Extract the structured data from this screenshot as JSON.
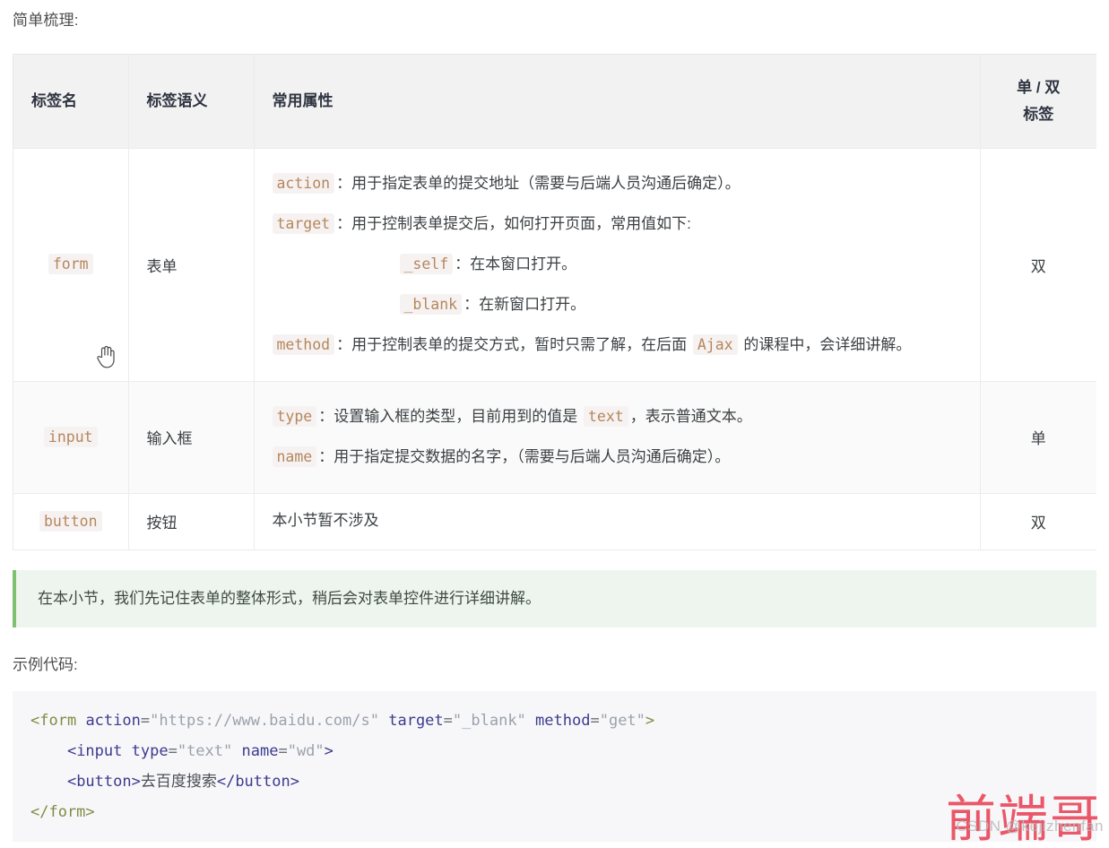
{
  "lead_text": "简单梳理:",
  "table": {
    "headers": {
      "name": "标签名",
      "semantic": "标签语义",
      "attributes": "常用属性",
      "pair_line1": "单 / 双",
      "pair_line2": "标签"
    },
    "rows": [
      {
        "tag": "form",
        "semantic": "表单",
        "pair": "双",
        "attributes": [
          {
            "code": "action",
            "text": "：用于指定表单的提交地址（需要与后端人员沟通后确定）。",
            "indent": false
          },
          {
            "code": "target",
            "text": "：用于控制表单提交后，如何打开页面，常用值如下:",
            "indent": false
          },
          {
            "code": "_self",
            "text": "：在本窗口打开。",
            "indent": true
          },
          {
            "code": "_blank",
            "text": "：在新窗口打开。",
            "indent": true
          },
          {
            "code": "method",
            "text_a": "：用于控制表单的提交方式，暂时只需了解，在后面 ",
            "code_b": "Ajax",
            "text_b": " 的课程中，会详细讲解。",
            "indent": false,
            "wrap": true
          }
        ]
      },
      {
        "tag": "input",
        "semantic": "输入框",
        "pair": "单",
        "attributes": [
          {
            "code": "type",
            "text_a": "：设置输入框的类型，目前用到的值是 ",
            "code_b": "text",
            "text_b": "，表示普通文本。",
            "indent": false
          },
          {
            "code": "name",
            "text": "：用于指定提交数据的名字，（需要与后端人员沟通后确定）。",
            "indent": false
          }
        ]
      },
      {
        "tag": "button",
        "semantic": "按钮",
        "pair": "双",
        "plain_attribute": "本小节暂不涉及"
      }
    ]
  },
  "callout": {
    "text": "在本小节，我们先记住表单的整体形式，稍后会对表单控件进行详细讲解。",
    "accent_color": "#7ec16f",
    "background_color": "#eef5ee"
  },
  "example": {
    "label": "示例代码:",
    "code_lines": [
      {
        "tokens": [
          {
            "t": "<form",
            "c": "tag-green"
          },
          {
            "t": " ",
            "c": "punct"
          },
          {
            "t": "action",
            "c": "attr"
          },
          {
            "t": "=",
            "c": "punct"
          },
          {
            "t": "\"https://www.baidu.com/s\"",
            "c": "str"
          },
          {
            "t": " ",
            "c": "punct"
          },
          {
            "t": "target",
            "c": "attr"
          },
          {
            "t": "=",
            "c": "punct"
          },
          {
            "t": "\"_blank\"",
            "c": "str"
          },
          {
            "t": " ",
            "c": "punct"
          },
          {
            "t": "method",
            "c": "attr"
          },
          {
            "t": "=",
            "c": "punct"
          },
          {
            "t": "\"get\"",
            "c": "str"
          },
          {
            "t": ">",
            "c": "tag-green"
          }
        ]
      },
      {
        "tokens": [
          {
            "t": "    ",
            "c": "punct"
          },
          {
            "t": "<input",
            "c": "tag-blue"
          },
          {
            "t": " ",
            "c": "punct"
          },
          {
            "t": "type",
            "c": "attr"
          },
          {
            "t": "=",
            "c": "punct"
          },
          {
            "t": "\"text\"",
            "c": "str"
          },
          {
            "t": " ",
            "c": "punct"
          },
          {
            "t": "name",
            "c": "attr"
          },
          {
            "t": "=",
            "c": "punct"
          },
          {
            "t": "\"wd\"",
            "c": "str"
          },
          {
            "t": ">",
            "c": "tag-blue"
          }
        ]
      },
      {
        "tokens": [
          {
            "t": "    ",
            "c": "punct"
          },
          {
            "t": "<button>",
            "c": "tag-blue"
          },
          {
            "t": "去百度搜索",
            "c": "text"
          },
          {
            "t": "</button>",
            "c": "tag-blue"
          }
        ]
      },
      {
        "tokens": [
          {
            "t": "</form>",
            "c": "tag-green"
          }
        ]
      }
    ]
  },
  "watermark": {
    "main": "前端哥",
    "sub": "CSDN @kejizhenfan",
    "color": "#e8354a"
  },
  "cursor": {
    "icon": "hand-cursor"
  }
}
